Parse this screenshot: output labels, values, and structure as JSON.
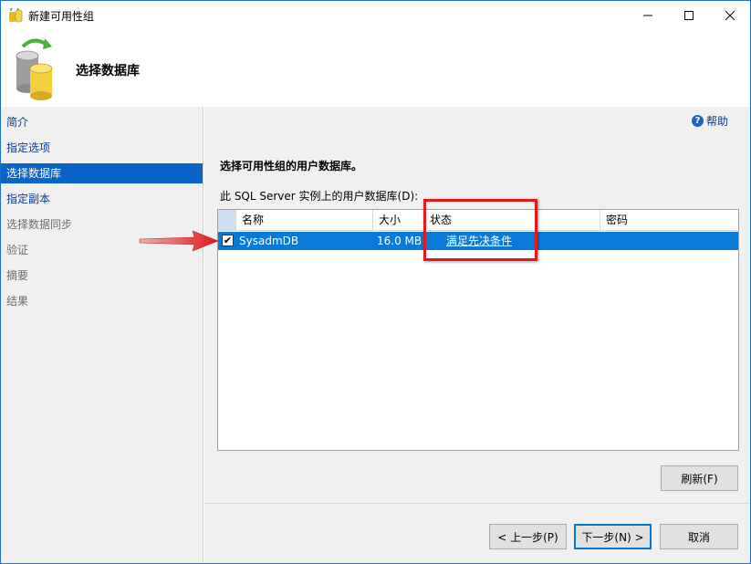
{
  "window": {
    "title": "新建可用性组"
  },
  "header": {
    "title": "选择数据库"
  },
  "nav": {
    "items": [
      {
        "label": "简介",
        "state": "normal"
      },
      {
        "label": "指定选项",
        "state": "normal"
      },
      {
        "label": "选择数据库",
        "state": "selected"
      },
      {
        "label": "指定副本",
        "state": "normal"
      },
      {
        "label": "选择数据同步",
        "state": "disabled"
      },
      {
        "label": "验证",
        "state": "disabled"
      },
      {
        "label": "摘要",
        "state": "disabled"
      },
      {
        "label": "结果",
        "state": "disabled"
      }
    ]
  },
  "content": {
    "help_label": "帮助",
    "section_title": "选择可用性组的用户数据库。",
    "grid_label": "此 SQL Server 实例上的用户数据库(D):",
    "columns": [
      "名称",
      "大小",
      "状态",
      "密码"
    ],
    "rows": [
      {
        "checked": true,
        "name": "SysadmDB",
        "size": "16.0 MB",
        "status": "满足先决条件",
        "password": ""
      }
    ],
    "refresh_label": "刷新(F)"
  },
  "buttons": {
    "back": "< 上一步(P)",
    "next": "下一步(N) >",
    "cancel": "取消"
  },
  "colors": {
    "selection": "#0a7ad6",
    "nav_selected": "#0a64c8",
    "annotation": "#e0191c"
  }
}
